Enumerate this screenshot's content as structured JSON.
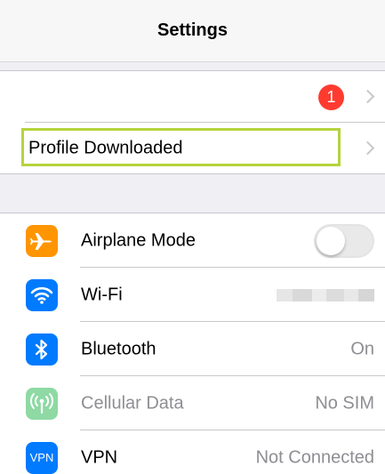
{
  "nav": {
    "title": "Settings"
  },
  "top_group": {
    "notification_badge": "1",
    "profile_row": {
      "label": "Profile Downloaded"
    }
  },
  "settings": {
    "items": [
      {
        "label": "Airplane Mode",
        "icon": "airplane-icon",
        "icon_color": "#ff9500",
        "toggle_on": false
      },
      {
        "label": "Wi-Fi",
        "icon": "wifi-icon",
        "icon_color": "#007aff"
      },
      {
        "label": "Bluetooth",
        "icon": "bluetooth-icon",
        "icon_color": "#007aff",
        "value": "On"
      },
      {
        "label": "Cellular Data",
        "icon": "cellular-antenna-icon",
        "icon_color": "#8ed9a4",
        "value": "No SIM"
      },
      {
        "label": "VPN",
        "icon": "vpn-icon",
        "icon_color": "#007aff",
        "icon_text": "VPN",
        "value": "Not Connected"
      }
    ]
  },
  "colors": {
    "highlight_border": "#b5d33d",
    "badge": "#ff3b30",
    "background": "#efeff4"
  }
}
